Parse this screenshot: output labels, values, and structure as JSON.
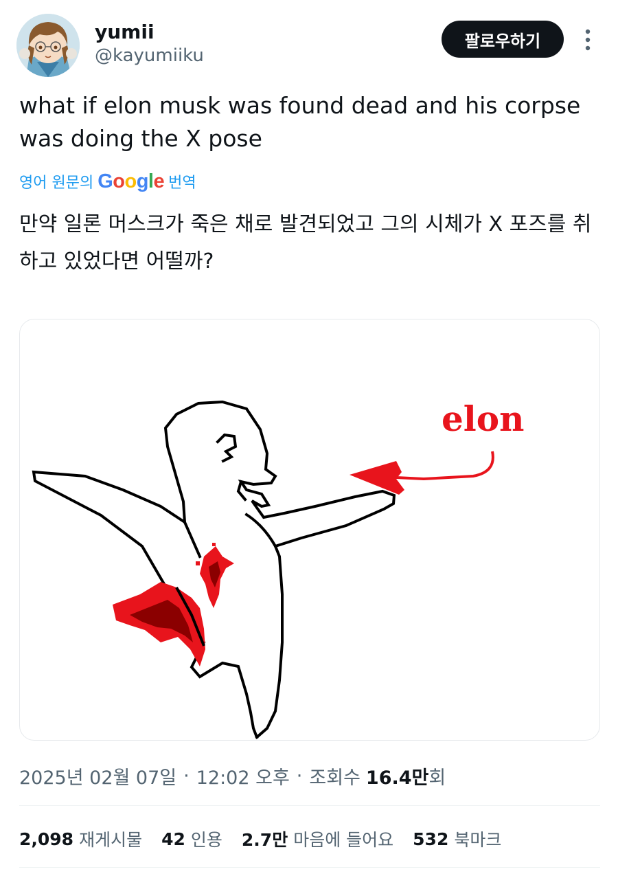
{
  "author": {
    "display_name": "yumii",
    "handle": "@kayumiiku"
  },
  "follow_button_label": "팔로우하기",
  "tweet": {
    "text": "what if elon musk was found dead and his corpse was doing the X pose",
    "translate_prefix": "영어 원문의",
    "translate_brand": "Google",
    "translate_suffix": "번역",
    "translated_text": "만약 일론 머스크가 죽은 채로 발견되었고 그의 시체가 X 포즈를 취하고 있었다면 어떨까?"
  },
  "media": {
    "annotation_text": "elon"
  },
  "meta": {
    "date": "2025년 02월 07일",
    "time": "12:02 오후",
    "views_label": "조회수",
    "views_value": "16.4만",
    "views_unit": "회"
  },
  "stats": {
    "reposts_value": "2,098",
    "reposts_label": "재게시물",
    "quotes_value": "42",
    "quotes_label": "인용",
    "likes_value": "2.7만",
    "likes_label": "마음에 들어요",
    "bookmarks_value": "532",
    "bookmarks_label": "북마크"
  },
  "colors": {
    "google_blue": "#4285F4",
    "google_red": "#EA4335",
    "google_yellow": "#FBBC05",
    "google_green": "#34A853",
    "link_blue": "#1d9bf0",
    "blood_red": "#e8141c",
    "blood_dark": "#8b0000"
  }
}
